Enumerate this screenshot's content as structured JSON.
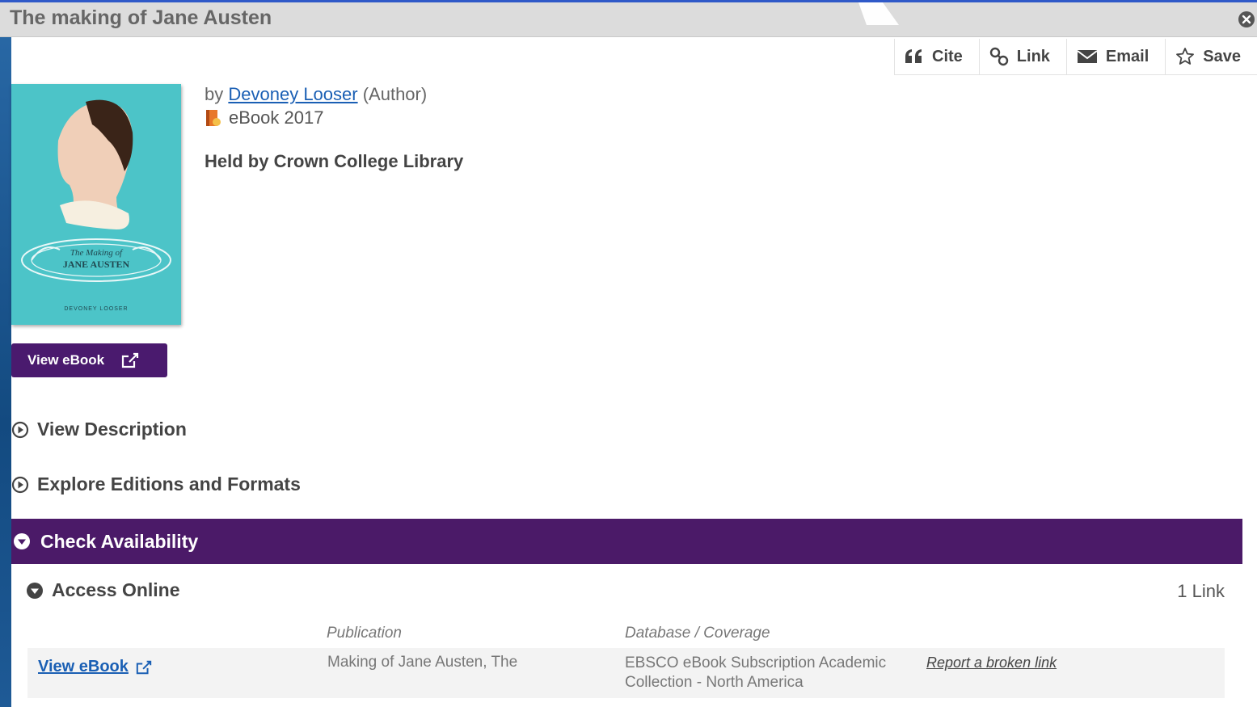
{
  "window": {
    "title": "The making of Jane Austen"
  },
  "toolbar": {
    "cite": "Cite",
    "link": "Link",
    "email": "Email",
    "save": "Save"
  },
  "record": {
    "by": "by",
    "author": "Devoney Looser",
    "author_role": "(Author)",
    "format": "eBook 2017",
    "held_by": "Held by Crown College Library",
    "cover_title_line1": "The Making of",
    "cover_title_line2": "JANE AUSTEN",
    "cover_author": "DEVONEY LOOSER"
  },
  "actions": {
    "view_ebook": "View eBook"
  },
  "sections": {
    "view_description": "View Description",
    "explore_editions": "Explore Editions and Formats",
    "check_availability": "Check Availability"
  },
  "access": {
    "heading": "Access Online",
    "count": "1 Link",
    "col_publication": "Publication",
    "col_database": "Database / Coverage",
    "rows": [
      {
        "link": "View eBook",
        "publication": "Making of Jane Austen, The",
        "database": "EBSCO eBook Subscription Academic Collection - North America",
        "report": "Report a broken link"
      }
    ]
  },
  "colors": {
    "purple": "#4b1a68",
    "link_blue": "#1a5fb4",
    "cover_teal": "#4cc4c8"
  }
}
